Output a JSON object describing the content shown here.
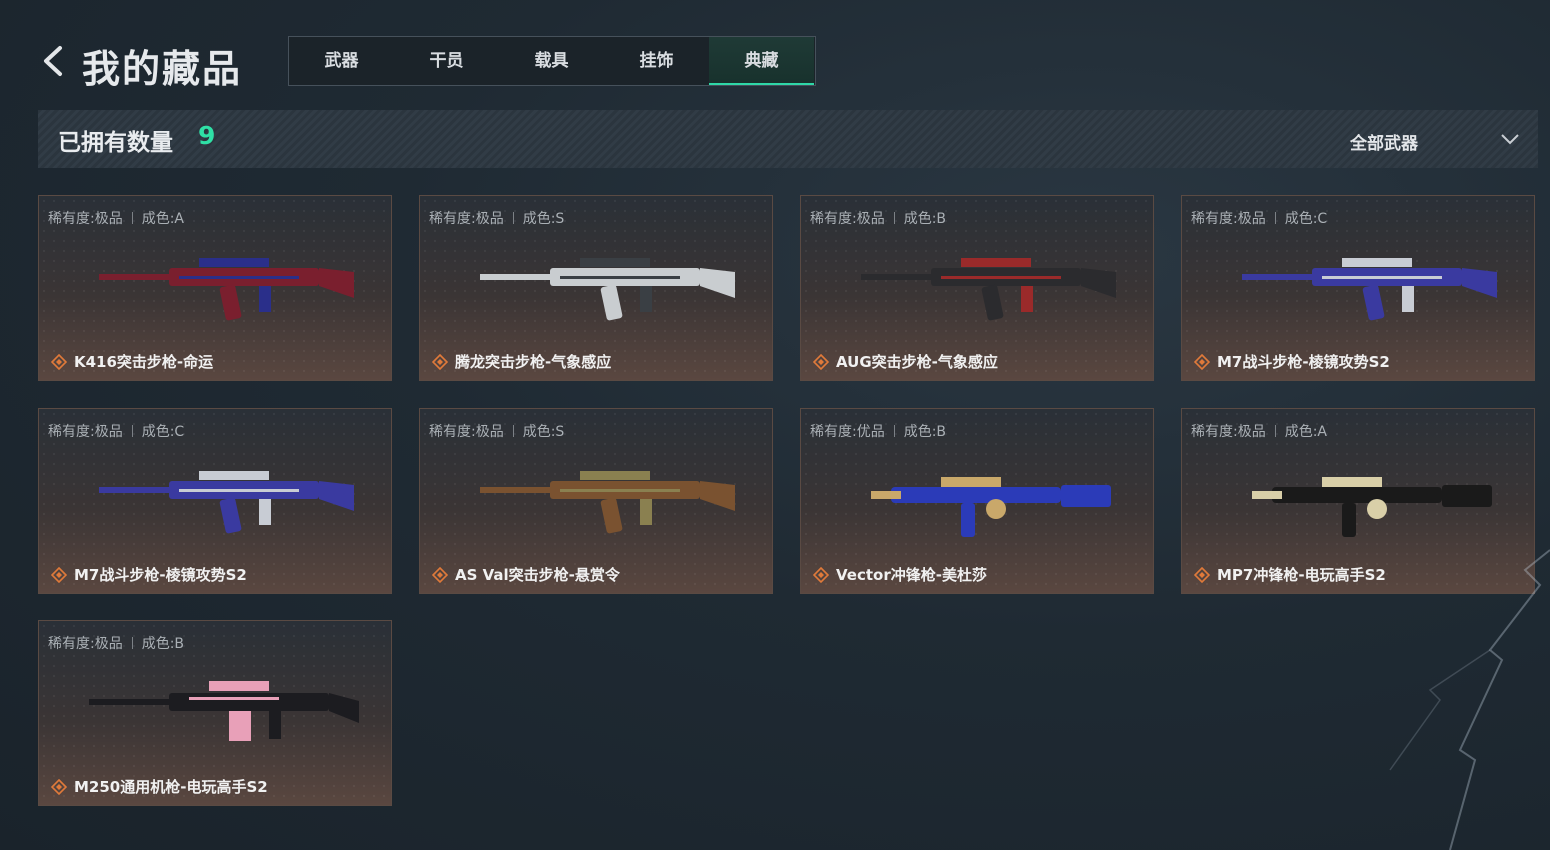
{
  "header": {
    "title": "我的藏品",
    "tabs": [
      {
        "label": "武器",
        "active": false
      },
      {
        "label": "干员",
        "active": false
      },
      {
        "label": "载具",
        "active": false
      },
      {
        "label": "挂饰",
        "active": false
      },
      {
        "label": "典藏",
        "active": true
      }
    ]
  },
  "summary": {
    "count_label": "已拥有数量",
    "count_value": "9",
    "filter_label": "全部武器"
  },
  "colors": {
    "accent": "#2fe0a6",
    "rarity_orange": "#e07a3a"
  },
  "items": [
    {
      "rarity": "稀有度:极品",
      "condition": "成色:A",
      "name": "K416突击步枪-命运",
      "icon": "rifle-icon",
      "color": "#7a1f2e",
      "accent": "#2a2f8a"
    },
    {
      "rarity": "稀有度:极品",
      "condition": "成色:S",
      "name": "腾龙突击步枪-气象感应",
      "icon": "rifle-icon",
      "color": "#c9cdd0",
      "accent": "#3a3f44"
    },
    {
      "rarity": "稀有度:极品",
      "condition": "成色:B",
      "name": "AUG突击步枪-气象感应",
      "icon": "rifle-icon",
      "color": "#2b2b2e",
      "accent": "#9a2a2a"
    },
    {
      "rarity": "稀有度:极品",
      "condition": "成色:C",
      "name": "M7战斗步枪-棱镜攻势S2",
      "icon": "rifle-icon",
      "color": "#3a3aa0",
      "accent": "#c8ccd4"
    },
    {
      "rarity": "稀有度:极品",
      "condition": "成色:C",
      "name": "M7战斗步枪-棱镜攻势S2",
      "icon": "rifle-icon",
      "color": "#3a3aa0",
      "accent": "#c8ccd4"
    },
    {
      "rarity": "稀有度:极品",
      "condition": "成色:S",
      "name": "AS Val突击步枪-悬赏令",
      "icon": "rifle-icon",
      "color": "#7a5230",
      "accent": "#8a8050"
    },
    {
      "rarity": "稀有度:优品",
      "condition": "成色:B",
      "name": "Vector冲锋枪-美杜莎",
      "icon": "smg-icon",
      "color": "#2b3bb8",
      "accent": "#c9a86a"
    },
    {
      "rarity": "稀有度:极品",
      "condition": "成色:A",
      "name": "MP7冲锋枪-电玩高手S2",
      "icon": "smg-icon",
      "color": "#1a1a1a",
      "accent": "#d9cfa8"
    },
    {
      "rarity": "稀有度:极品",
      "condition": "成色:B",
      "name": "M250通用机枪-电玩高手S2",
      "icon": "machine-gun-icon",
      "color": "#1c1c20",
      "accent": "#e8a0b8"
    }
  ]
}
